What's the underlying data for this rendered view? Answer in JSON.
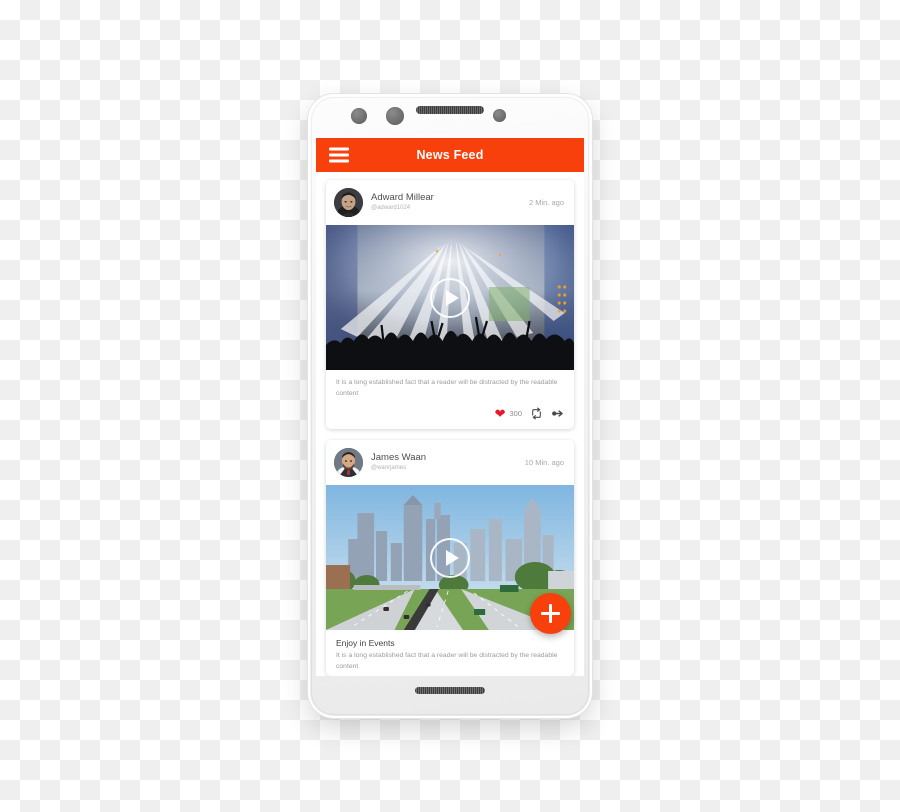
{
  "device": {
    "name": "white-android-smartphone",
    "frame_color": "#f2f2f2",
    "top_speaker": "earpiece-speaker-grille",
    "bottom_speaker": "bottom-speaker-grille"
  },
  "appbar": {
    "title": "News Feed",
    "background": "#f7400c",
    "menu_icon": "hamburger-menu-icon"
  },
  "feed": {
    "posts": [
      {
        "user": "Adward Millear",
        "handle": "@adward1024",
        "time": "2 Min. ago",
        "media_type": "video",
        "media_caption": "concert-stage-lights-crowd",
        "title": "",
        "text": "It is a long established fact that a reader will be distracted by the readable content",
        "like_count": "300",
        "actions": {
          "like": "heart-icon",
          "repost": "retweet-icon",
          "share": "share-arrow-icon"
        }
      },
      {
        "user": "James Waan",
        "handle": "@wanrjames",
        "time": "10 Min. ago",
        "media_type": "video",
        "media_caption": "city-skyline-highway",
        "title": "Enjoy in Events",
        "text": "It is a long established fact that a reader will be distracted by the readable content",
        "like_count": "",
        "actions": {}
      }
    ]
  },
  "fab": {
    "label": "+",
    "name": "add-post-button",
    "color": "#f7400c"
  },
  "colors": {
    "accent": "#f7400c",
    "like": "#e8192c",
    "muted_text": "#9b9b9b",
    "title_text": "#4e4e4e",
    "backdrop_checker": "#efefef"
  }
}
